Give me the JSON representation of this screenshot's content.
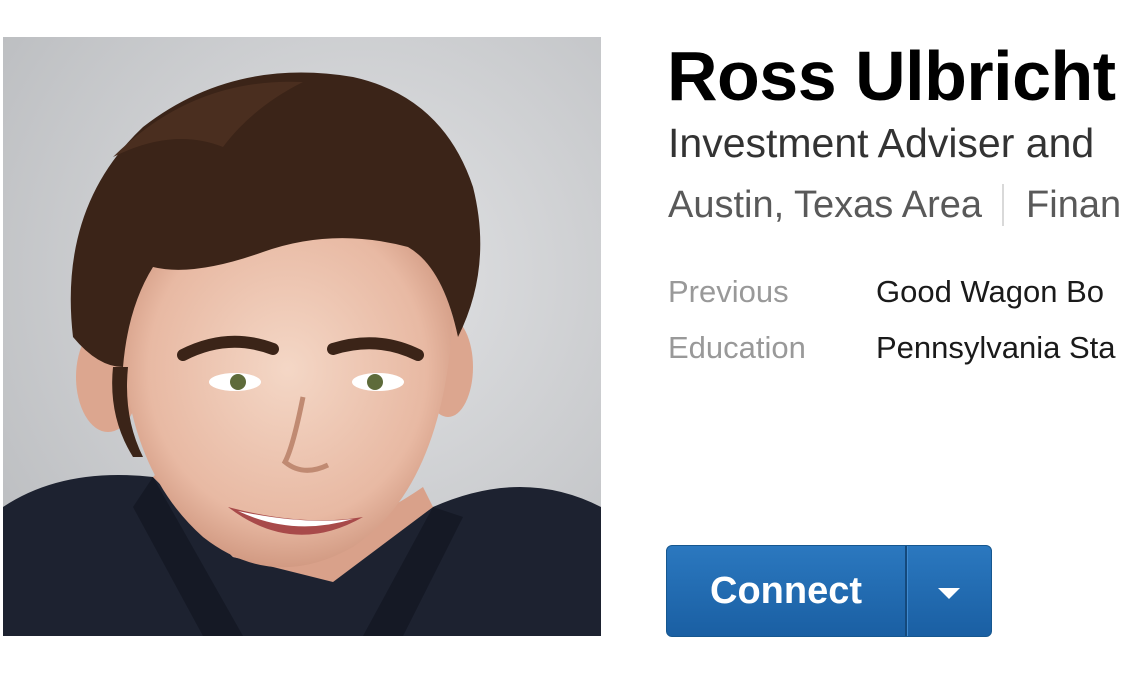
{
  "profile": {
    "name": "Ross Ulbricht",
    "headline": "Investment Adviser and",
    "location": "Austin, Texas Area",
    "industry": "Finan"
  },
  "info": [
    {
      "label": "Previous",
      "value": "Good Wagon Bo"
    },
    {
      "label": "Education",
      "value": "Pennsylvania Sta"
    }
  ],
  "actions": {
    "connect_label": "Connect",
    "dropdown_icon": "chevron-down-icon"
  },
  "colors": {
    "button": "#2267b0",
    "name": "#000000",
    "muted": "#999999"
  }
}
